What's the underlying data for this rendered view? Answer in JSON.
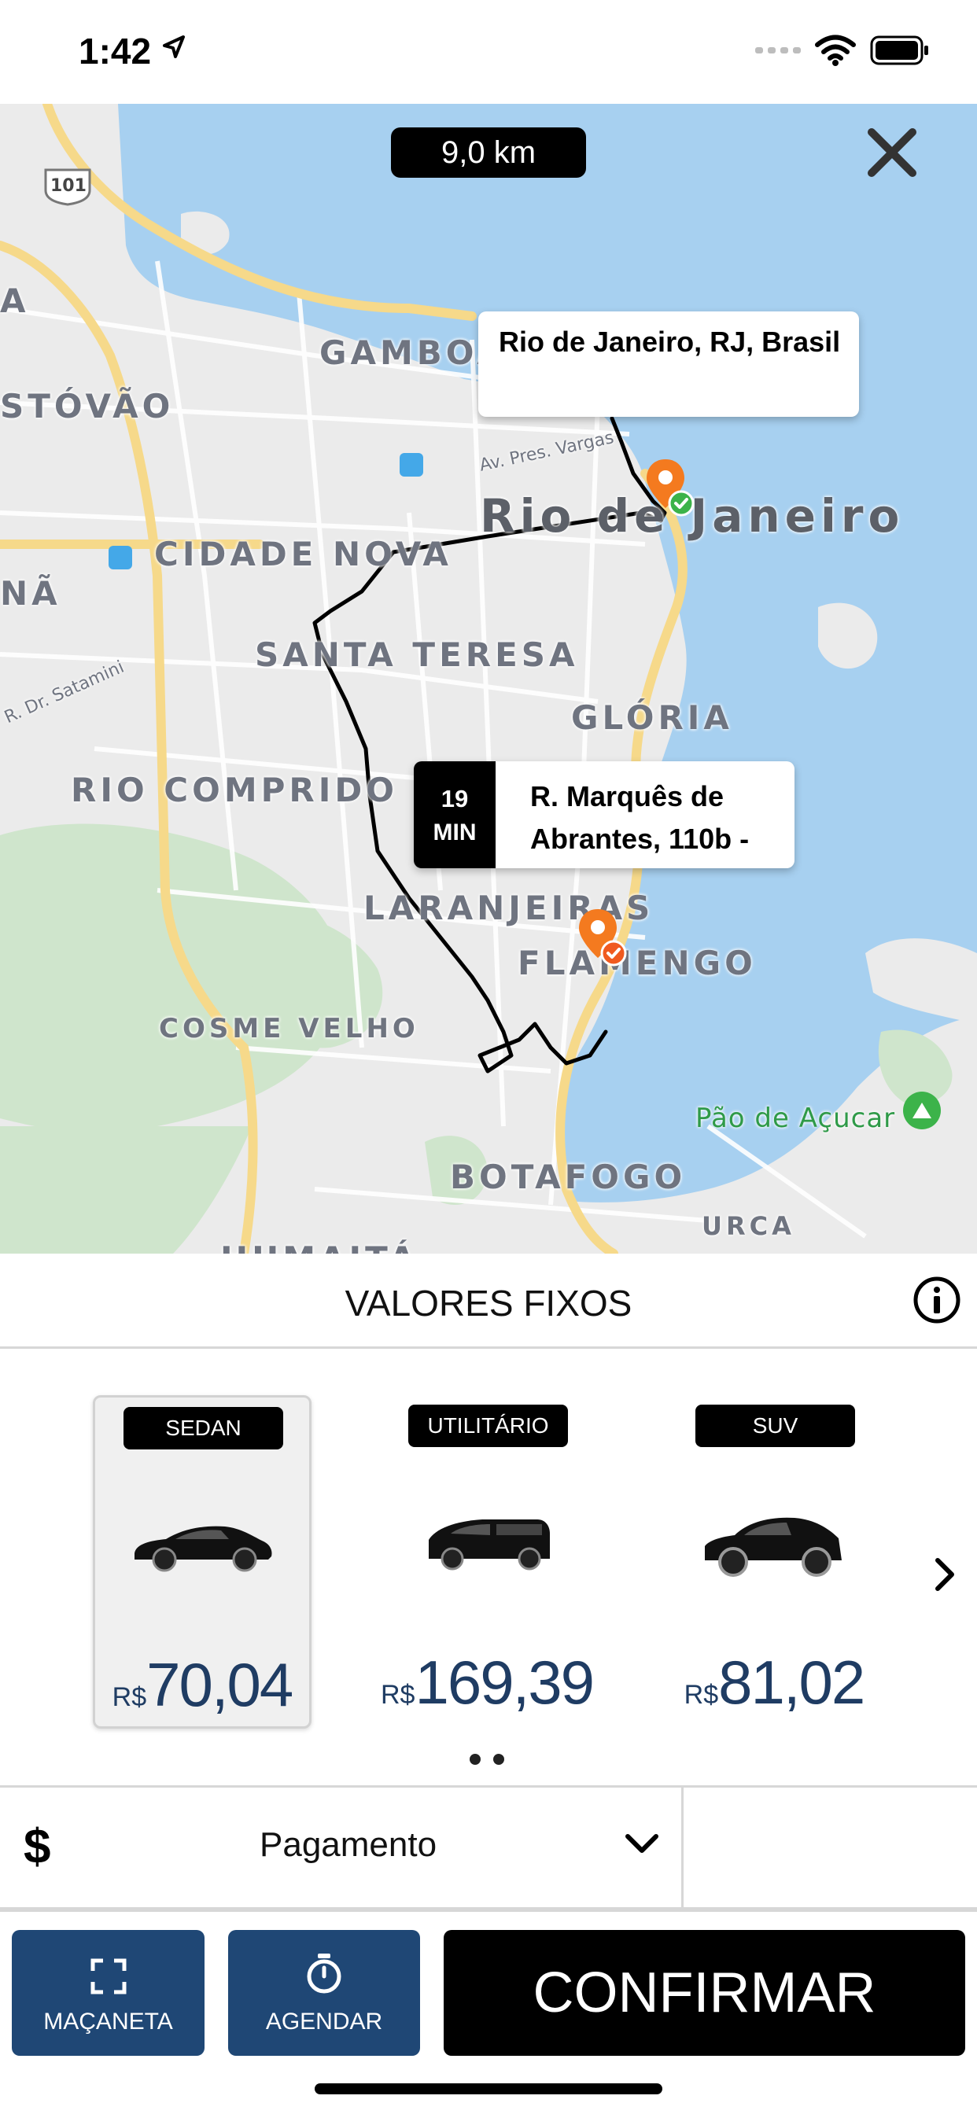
{
  "status_bar": {
    "time": "1:42"
  },
  "map": {
    "distance": "9,0 km",
    "labels": {
      "highway": "101",
      "gamboa": "GAMBOA",
      "sao_cristovao": "STÓVÃO",
      "rio": "Rio de Janeiro",
      "cidade_nova": "CIDADE NOVA",
      "santa_teresa": "SANTA TERESA",
      "gloria": "GLÓRIA",
      "rio_comprido": "RIO COMPRIDO",
      "laranjeiras": "LARANJEIRAS",
      "flamengo": "FLAMENGO",
      "cosme_velho": "COSME VELHO",
      "pao_de_acucar": "Pão de Açucar",
      "botafogo": "BOTAFOGO",
      "urca": "URCA",
      "humaita": "HUMAITÁ",
      "street_vargas": "Av. Pres. Vargas",
      "street_satamini": "R. Dr. Satamini",
      "edge_a": "A",
      "edge_na": "NÃ"
    },
    "destination_callout": "Rio de Janeiro, RJ, Brasil",
    "origin_callout": {
      "eta_value": "19",
      "eta_unit": "MIN",
      "address": "R. Marquês de Abrantes, 110b -"
    }
  },
  "section": {
    "title": "VALORES FIXOS"
  },
  "vehicles": [
    {
      "type": "SEDAN",
      "currency": "R$",
      "price": "70,04",
      "selected": true
    },
    {
      "type": "UTILITÁRIO",
      "currency": "R$",
      "price": "169,39",
      "selected": false
    },
    {
      "type": "SUV",
      "currency": "R$",
      "price": "81,02",
      "selected": false
    }
  ],
  "payment": {
    "currency_symbol": "$",
    "label": "Pagamento"
  },
  "actions": {
    "macaneta": "MAÇANETA",
    "agendar": "AGENDAR",
    "confirm": "CONFIRMAR"
  },
  "colors": {
    "water": "#a7d0f0",
    "land": "#ebebeb",
    "park": "#cfe5cc",
    "road_major": "#f6d98a",
    "route": "#000000",
    "marker": "#f47a1f",
    "marker_check": "#3cb34a",
    "button_blue": "#1f4775",
    "price_blue": "#1f3c63"
  }
}
